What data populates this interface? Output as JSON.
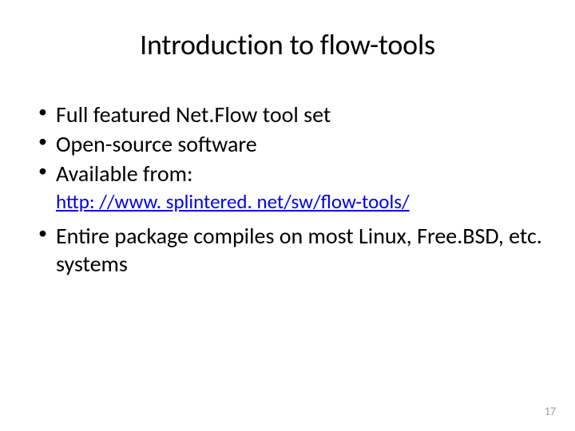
{
  "title": "Introduction to flow-tools",
  "bullets": [
    "Full featured Net.Flow tool set",
    "Open-source software",
    "Available from:"
  ],
  "link": "http: //www. splintered. net/sw/flow-tools/",
  "bullets2": [
    "Entire package compiles on most Linux, Free.BSD, etc. systems"
  ],
  "pageNumber": "17"
}
